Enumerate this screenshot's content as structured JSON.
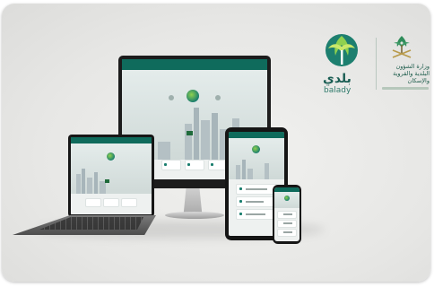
{
  "branding": {
    "app_name_ar": "بلدي",
    "app_name_en": "balady",
    "ministry_name_ar": "وزارة الشؤون البلدية والقروية والإسكان"
  },
  "colors": {
    "primary_green": "#0f6b5c",
    "accent_green": "#8fd14f",
    "background": "#e7e7e5"
  },
  "devices": [
    "desktop-monitor",
    "laptop",
    "tablet",
    "phone"
  ]
}
